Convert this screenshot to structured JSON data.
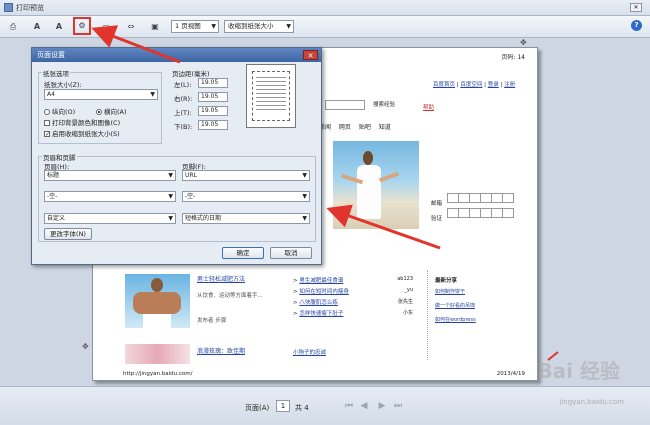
{
  "window": {
    "title": "打印预览"
  },
  "toolbar": {
    "page_view_select": "1 页视图",
    "size_select": "收缩到纸张大小",
    "help_label": "?"
  },
  "page_setup_dialog": {
    "title": "页面设置",
    "paper_options_label": "纸张选项",
    "paper_size_label": "纸张大小(Z):",
    "paper_size_value": "A4",
    "portrait_label": "纵向(O)",
    "landscape_label": "横向(A)",
    "print_bg_label": "打印背景颜色和图像(C)",
    "shrink_label": "启用收缩到纸张大小(S)",
    "margins_label": "页边距(毫米)",
    "left_label": "左(L):",
    "right_label": "右(R):",
    "top_label": "上(T):",
    "bottom_label": "下(B):",
    "left_value": "19.05",
    "right_value": "19.05",
    "top_value": "19.05",
    "bottom_value": "19.05",
    "header_footer_label": "页眉和页脚",
    "header_label": "页眉(H):",
    "footer_label": "页脚(F):",
    "header_row1": "标题",
    "footer_row1": "URL",
    "header_row2": "-空-",
    "footer_row2": "-空-",
    "header_row3": "自定义",
    "footer_row3": "短格式的日期",
    "font_button": "更改字体(N)",
    "ok_button": "确定",
    "cancel_button": "取消"
  },
  "preview_page": {
    "page_counter": "页码: 14",
    "nav_links": [
      "百度首页",
      "百度空间",
      "登录",
      "注册"
    ],
    "tabs_text": "新闻  网页  贴吧  知道",
    "search_btn": "搜索经验",
    "help_link": "帮助",
    "article1_title": "男士轻松减肥方法",
    "article1_desc": "从饮食、运动等方面着手...",
    "article1_meta": "发布者  步骤",
    "list1": [
      "男生减肥最佳食谱",
      "如何在短时间内瘦身",
      "八块腹肌怎么练",
      "怎样快速瘦下肚子"
    ],
    "list1_meta": [
      "ab123",
      "_yu",
      "张先生",
      "小东"
    ],
    "article2_title": "浪漫玫瑰：致佳期",
    "list2": [
      "小狗子的忠诚"
    ],
    "sidebar_title": "最新分享",
    "sidebar_items": [
      "如何制作饼干",
      "做一个好看的吊饰",
      "如何在wordpress"
    ],
    "form_label1": "邮箱",
    "form_label2": "验证",
    "footer_url": "http://jingyan.baidu.com/",
    "footer_page": "2013/4/19"
  },
  "statusbar": {
    "page_label": "页面(A)",
    "page_value": "1",
    "total_label": "共 4"
  },
  "watermark": {
    "text": "Bai 经验",
    "url": "jingyan.baidu.com"
  },
  "colors": {
    "arrow": "#e0342c",
    "accent": "#3e65a3"
  }
}
